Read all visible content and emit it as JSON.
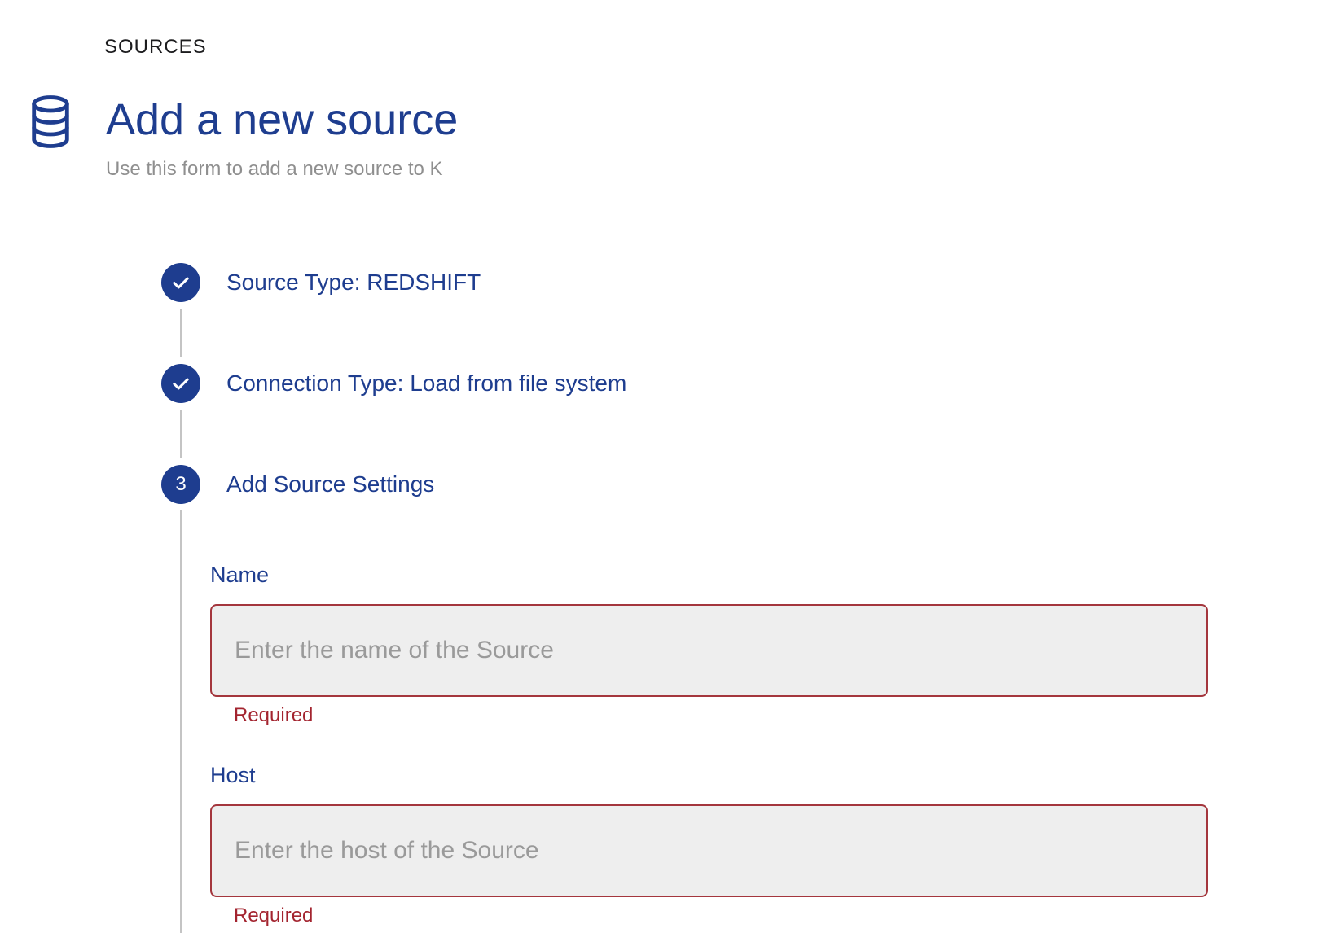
{
  "breadcrumb": "SOURCES",
  "header": {
    "icon": "database-icon",
    "title": "Add a new source",
    "subtitle": "Use this form to add a new source to K"
  },
  "stepper": {
    "steps": [
      {
        "label": "Source Type: REDSHIFT",
        "state": "completed",
        "icon": "check-icon"
      },
      {
        "label": "Connection Type: Load from file system",
        "state": "completed",
        "icon": "check-icon"
      },
      {
        "label": "Add Source Settings",
        "state": "active",
        "number": "3"
      }
    ]
  },
  "form": {
    "fields": [
      {
        "label": "Name",
        "placeholder": "Enter the name of the Source",
        "value": "",
        "error": "Required"
      },
      {
        "label": "Host",
        "placeholder": "Enter the host of the Source",
        "value": "",
        "error": "Required"
      }
    ]
  },
  "colors": {
    "primary_navy": "#1e3d8f",
    "error_red": "#a3242f",
    "input_border_red": "#a4363d",
    "input_bg": "#eeeeee",
    "connector_gray": "#c4c4c4",
    "subtitle_gray": "#8f8f8f",
    "breadcrumb_text": "#1c1c1e"
  }
}
